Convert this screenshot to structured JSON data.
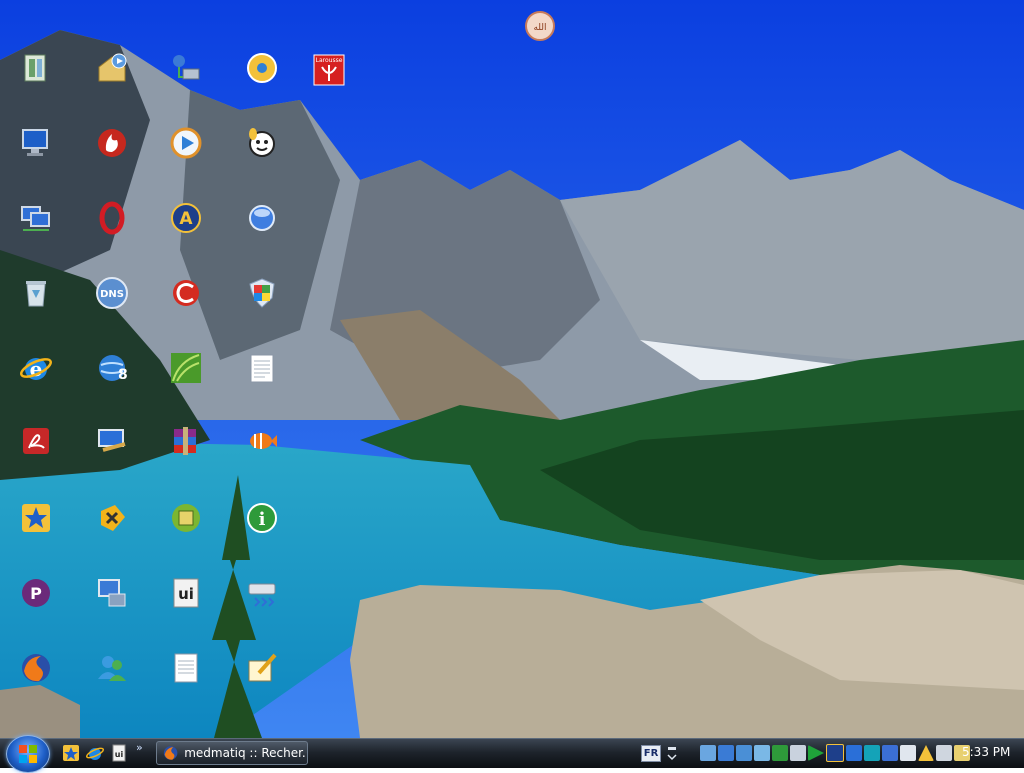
{
  "desktop": {
    "top_icon": "prayer-app-icon",
    "icons": [
      {
        "id": "explorer-icon"
      },
      {
        "id": "home-folder-icon"
      },
      {
        "id": "network-places-icon"
      },
      {
        "id": "media-center-icon"
      },
      {
        "id": "larousse-icon",
        "label": "Larousse"
      },
      {
        "id": "computer-icon"
      },
      {
        "id": "fire-app-icon"
      },
      {
        "id": "media-player-icon"
      },
      {
        "id": "cartoon-app-icon"
      },
      {
        "id": "network-computer-icon"
      },
      {
        "id": "opera-icon"
      },
      {
        "id": "atlas-icon"
      },
      {
        "id": "blue-orb-icon"
      },
      {
        "id": "recycle-bin-icon"
      },
      {
        "id": "dns-icon",
        "label": "DNS"
      },
      {
        "id": "ccleaner-icon"
      },
      {
        "id": "security-center-icon"
      },
      {
        "id": "internet-explorer-icon"
      },
      {
        "id": "network-globe-icon"
      },
      {
        "id": "green-leaf-icon"
      },
      {
        "id": "notepad-icon"
      },
      {
        "id": "adobe-reader-icon"
      },
      {
        "id": "remote-desktop-icon"
      },
      {
        "id": "winrar-icon"
      },
      {
        "id": "fish-icon"
      },
      {
        "id": "star-app-icon"
      },
      {
        "id": "tools-app-icon"
      },
      {
        "id": "cpu-icon"
      },
      {
        "id": "info-icon"
      },
      {
        "id": "purple-p-icon"
      },
      {
        "id": "network-settings-icon"
      },
      {
        "id": "ui-app-icon",
        "label": "ui"
      },
      {
        "id": "drive-icon"
      },
      {
        "id": "firefox-icon"
      },
      {
        "id": "messenger-icon"
      },
      {
        "id": "document-icon"
      },
      {
        "id": "notepad-pen-icon"
      }
    ]
  },
  "taskbar": {
    "start_icon": "windows-logo-icon",
    "quick_launch": [
      "star-app-icon",
      "internet-explorer-icon",
      "ui-app-icon"
    ],
    "quick_launch_more": "»",
    "task_title": "medmatiq :: Recher...",
    "task_icon": "firefox-icon",
    "language": "FR",
    "tray_icons": [
      "keyboard-icon",
      "network-icon",
      "display-icon",
      "cloud-icon",
      "safely-remove-icon",
      "volume-icon",
      "play-icon",
      "atlas-icon",
      "tl-icon",
      "sync-icon",
      "bluetooth-icon",
      "shield-icon",
      "warning-icon",
      "power-icon",
      "user-icon"
    ],
    "clock": "5:33 PM"
  },
  "colors": {
    "sky": "#1557ee",
    "lake": "#16b3d6",
    "forest": "#1d5a2c",
    "taskbar": "#1e242c"
  }
}
